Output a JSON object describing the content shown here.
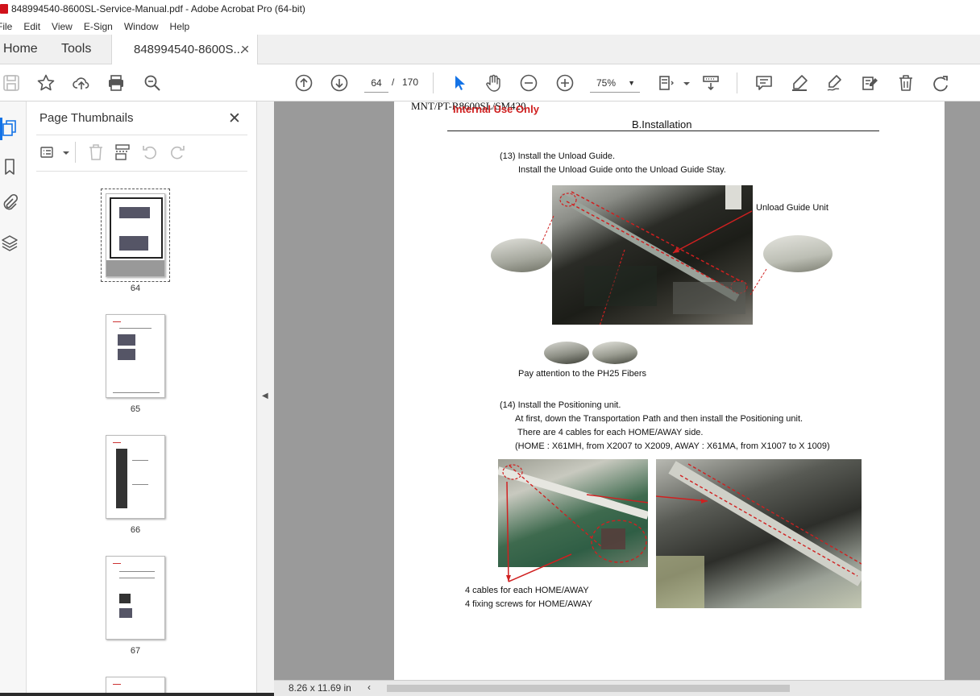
{
  "window": {
    "title": "848994540-8600SL-Service-Manual.pdf - Adobe Acrobat Pro (64-bit)"
  },
  "menu": [
    "File",
    "Edit",
    "View",
    "E-Sign",
    "Window",
    "Help"
  ],
  "tabs": {
    "home": "Home",
    "tools": "Tools",
    "document": "848994540-8600S..."
  },
  "toolbar": {
    "page_current": "64",
    "page_separator": "/",
    "page_total": "170",
    "zoom": "75%"
  },
  "panel": {
    "title": "Page Thumbnails",
    "thumbnails": [
      {
        "label": "64",
        "selected": true
      },
      {
        "label": "65",
        "selected": false
      },
      {
        "label": "66",
        "selected": false
      },
      {
        "label": "67",
        "selected": false
      }
    ]
  },
  "status": {
    "page_size": "8.26 x 11.69 in"
  },
  "page": {
    "header_model": "MNT/PT-R8600SL/SM420",
    "header_internal": "Internal Use Only",
    "header_section": "B.Installation",
    "step13_title": "(13) Install the Unload Guide.",
    "step13_line1": "Install the Unload Guide onto the Unload Guide Stay.",
    "callout_unload_guide_unit": "Unload Guide Unit",
    "callout_ph25": "Pay attention to the PH25 Fibers",
    "step14_title": "(14) Install the Positioning unit.",
    "step14_line1": "At first, down the Transportation Path and then install the Positioning unit.",
    "step14_line2": "There are 4 cables for each HOME/AWAY side.",
    "step14_line3": "(HOME : X61MH, from X2007 to X2009, AWAY : X61MA, from X1007 to X 1009)",
    "caption_cables": "4 cables for each HOME/AWAY",
    "caption_screws": "4 fixing screws for HOME/AWAY"
  },
  "colors": {
    "accent_blue": "#1473e6",
    "annotation_red": "#d02020",
    "doc_background": "#9a9a9a"
  }
}
